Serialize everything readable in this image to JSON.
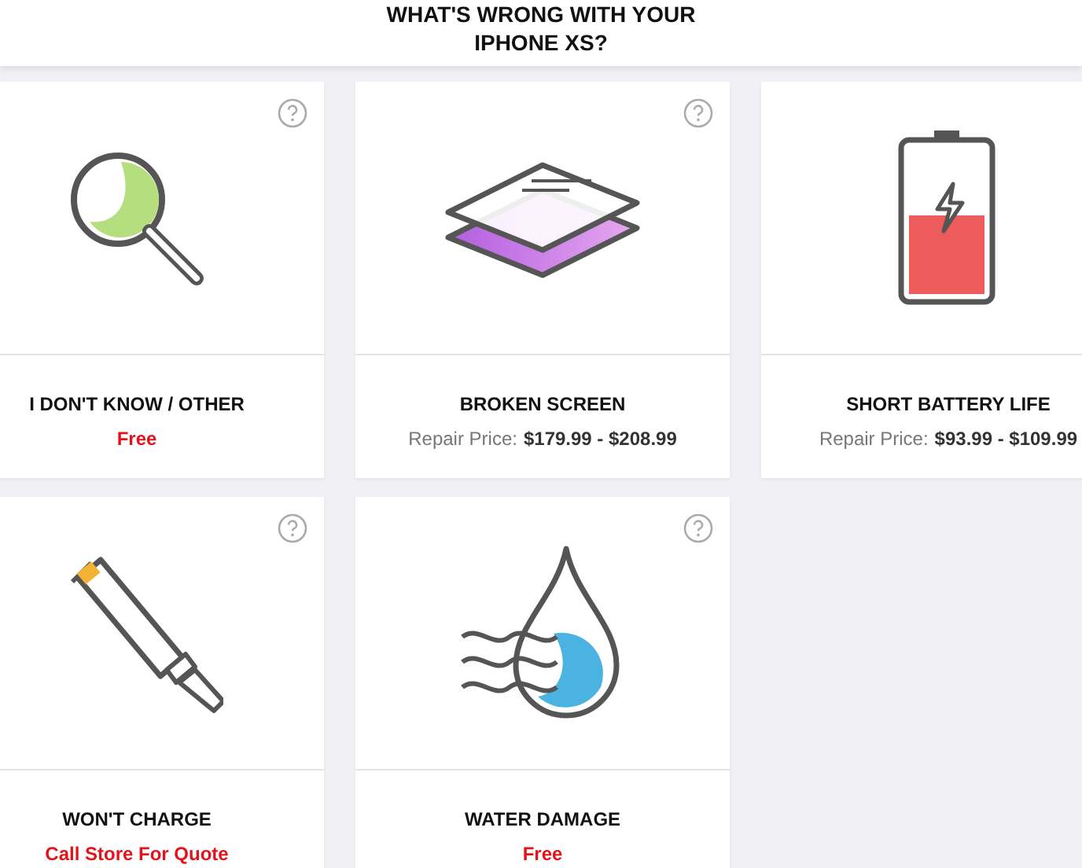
{
  "header": {
    "lines": [
      "WHAT'S WRONG WITH YOUR",
      "IPHONE XS?"
    ]
  },
  "issues": [
    {
      "kind": "magnifier",
      "title": "I DON'T KNOW / OTHER",
      "price": {
        "kind": "note",
        "text": "Free"
      }
    },
    {
      "kind": "screen",
      "title": "BROKEN SCREEN",
      "price": {
        "kind": "range",
        "label": "Repair Price:",
        "amount": "$179.99 - $208.99"
      }
    },
    {
      "kind": "battery",
      "title": "SHORT BATTERY LIFE",
      "price": {
        "kind": "range",
        "label": "Repair Price:",
        "amount": "$93.99 - $109.99"
      }
    },
    {
      "kind": "cable",
      "title": "WON'T CHARGE",
      "price": {
        "kind": "note",
        "text": "Call Store For Quote"
      }
    },
    {
      "kind": "water",
      "title": "WATER DAMAGE",
      "price": {
        "kind": "note",
        "text": "Free"
      }
    }
  ]
}
